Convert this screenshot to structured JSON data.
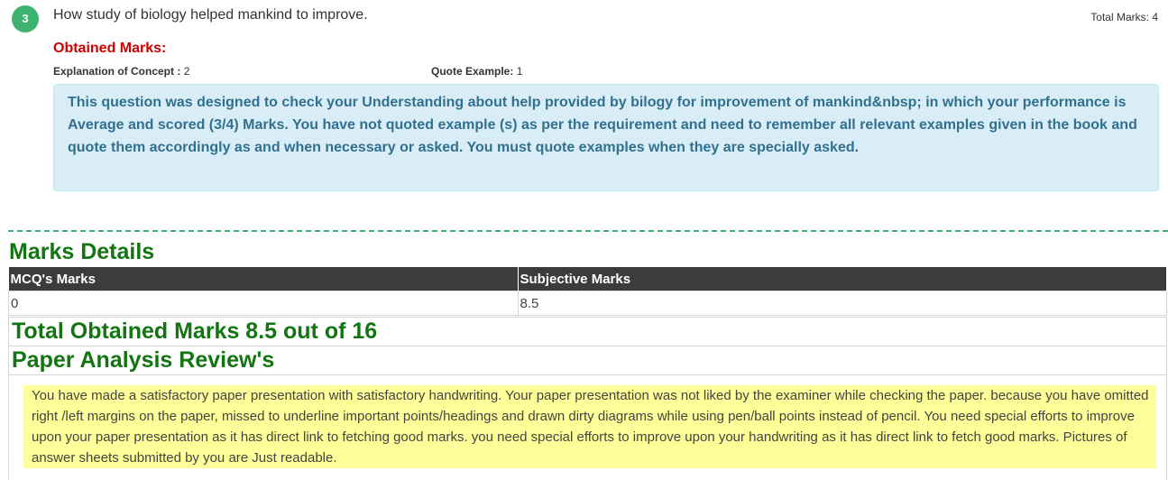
{
  "question": {
    "number": "3",
    "text": "How study of biology helped mankind to improve.",
    "total_marks": "Total Marks: 4"
  },
  "obtained": {
    "title": "Obtained Marks:",
    "criteria": [
      {
        "label": "Explanation of Concept :",
        "value": "2"
      },
      {
        "label": "Quote Example:",
        "value": "1"
      }
    ],
    "feedback": "This question was designed to check your Understanding about help provided by bilogy for improvement of mankind&nbsp; in which your performance is Average and scored (3/4) Marks. You have not quoted example (s) as per the requirement and need to remember all relevant examples given in the book and quote them accordingly as and when necessary or asked. You must quote examples when they are specially asked."
  },
  "marks_details": {
    "title": "Marks Details",
    "headers": [
      "MCQ's Marks",
      "Subjective Marks"
    ],
    "values": [
      "0",
      "8.5"
    ],
    "total": "Total Obtained Marks 8.5 out of 16"
  },
  "review": {
    "title": "Paper Analysis Review's",
    "text": "You have made a satisfactory paper presentation with satisfactory handwriting. Your paper presentation was not liked by the examiner while checking the paper. because you have omitted right /left margins on the paper, missed to underline important points/headings and drawn dirty diagrams while using pen/ball points instead of pencil. You need special efforts to improve upon your paper presentation as it has direct link to fetching good marks. you need special efforts to improve upon your handwriting as it has direct link to fetch good marks. Pictures of answer sheets submitted by you are Just readable."
  },
  "colors": {
    "badge": "#3cb371",
    "obtained_title": "#cc0000",
    "section_heading": "#127512",
    "info_bg": "#d9edf7",
    "info_text": "#31708f",
    "review_bg": "#ffff99",
    "table_header_bg": "#3c3c3c"
  }
}
